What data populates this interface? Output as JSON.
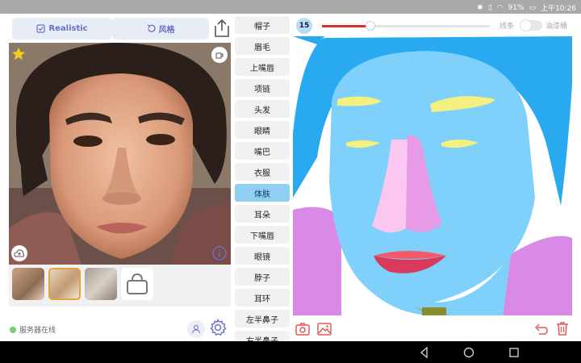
{
  "statusbar": {
    "battery": "91%",
    "time": "上午10:26"
  },
  "header": {
    "realistic_label": "Realistic",
    "style_label": "风格"
  },
  "server": {
    "status": "服务器在线"
  },
  "labels": [
    "帽子",
    "眉毛",
    "上嘴唇",
    "项链",
    "头发",
    "眼睛",
    "嘴巴",
    "衣服",
    "体肤",
    "耳朵",
    "下嘴唇",
    "眼镜",
    "脖子",
    "耳环",
    "左半鼻子",
    "右半鼻子"
  ],
  "active_label_index": 8,
  "brush": {
    "size": "15",
    "level": 0.29
  },
  "toggle": {
    "left_label": "线条",
    "right_label": "油漆桶",
    "on": false
  },
  "colors": {
    "accent": "#6a6ec9",
    "active_item": "#8fcff2",
    "skin": "#7fd0fb",
    "hair": "#29aaf0",
    "clothes": "#d98ae6",
    "delete": "#e05a5a"
  }
}
